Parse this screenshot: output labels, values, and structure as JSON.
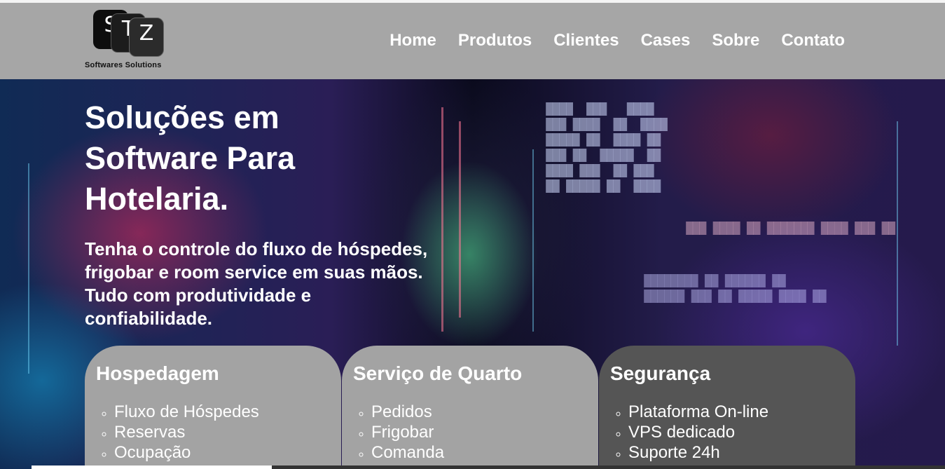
{
  "header": {
    "logo": {
      "letters": [
        "S",
        "T",
        "Z"
      ],
      "tagline": "Softwares Solutions"
    },
    "nav": [
      {
        "label": "Home"
      },
      {
        "label": "Produtos"
      },
      {
        "label": "Clientes"
      },
      {
        "label": "Cases"
      },
      {
        "label": "Sobre"
      },
      {
        "label": "Contato"
      }
    ]
  },
  "hero": {
    "title": "Soluções em Software Para Hotelaria.",
    "subtitle": "Tenha o controle do fluxo de hóspedes, frigobar e room service em suas mãos. Tudo com produtividade e confiabilidade."
  },
  "cards": [
    {
      "title": "Hospedagem",
      "items": [
        "Fluxo de Hóspedes",
        "Reservas",
        "Ocupação"
      ]
    },
    {
      "title": "Serviço de Quarto",
      "items": [
        "Pedidos",
        "Frigobar",
        "Comanda"
      ]
    },
    {
      "title": "Segurança",
      "items": [
        "Plataforma On-line",
        "VPS dedicado",
        "Suporte 24h"
      ]
    }
  ],
  "colors": {
    "header_bg": "#a6a6a6",
    "card_light": "#a3a3a3",
    "card_dark": "#555555",
    "text": "#ffffff"
  }
}
